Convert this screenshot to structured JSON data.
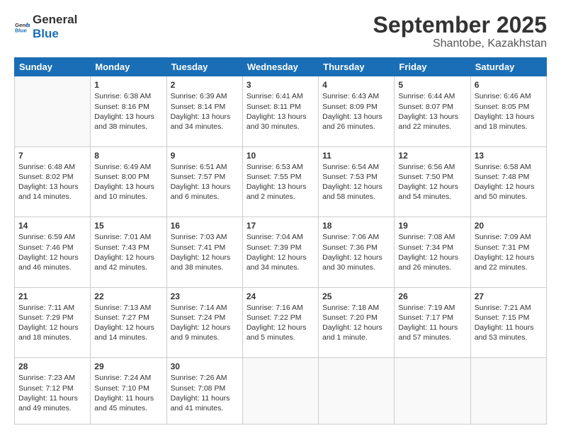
{
  "header": {
    "logo_general": "General",
    "logo_blue": "Blue",
    "month_title": "September 2025",
    "location": "Shantobe, Kazakhstan"
  },
  "days_of_week": [
    "Sunday",
    "Monday",
    "Tuesday",
    "Wednesday",
    "Thursday",
    "Friday",
    "Saturday"
  ],
  "weeks": [
    [
      {
        "day": "",
        "sunrise": "",
        "sunset": "",
        "daylight": "",
        "empty": true
      },
      {
        "day": "1",
        "sunrise": "Sunrise: 6:38 AM",
        "sunset": "Sunset: 8:16 PM",
        "daylight": "Daylight: 13 hours and 38 minutes."
      },
      {
        "day": "2",
        "sunrise": "Sunrise: 6:39 AM",
        "sunset": "Sunset: 8:14 PM",
        "daylight": "Daylight: 13 hours and 34 minutes."
      },
      {
        "day": "3",
        "sunrise": "Sunrise: 6:41 AM",
        "sunset": "Sunset: 8:11 PM",
        "daylight": "Daylight: 13 hours and 30 minutes."
      },
      {
        "day": "4",
        "sunrise": "Sunrise: 6:43 AM",
        "sunset": "Sunset: 8:09 PM",
        "daylight": "Daylight: 13 hours and 26 minutes."
      },
      {
        "day": "5",
        "sunrise": "Sunrise: 6:44 AM",
        "sunset": "Sunset: 8:07 PM",
        "daylight": "Daylight: 13 hours and 22 minutes."
      },
      {
        "day": "6",
        "sunrise": "Sunrise: 6:46 AM",
        "sunset": "Sunset: 8:05 PM",
        "daylight": "Daylight: 13 hours and 18 minutes."
      }
    ],
    [
      {
        "day": "7",
        "sunrise": "Sunrise: 6:48 AM",
        "sunset": "Sunset: 8:02 PM",
        "daylight": "Daylight: 13 hours and 14 minutes."
      },
      {
        "day": "8",
        "sunrise": "Sunrise: 6:49 AM",
        "sunset": "Sunset: 8:00 PM",
        "daylight": "Daylight: 13 hours and 10 minutes."
      },
      {
        "day": "9",
        "sunrise": "Sunrise: 6:51 AM",
        "sunset": "Sunset: 7:57 PM",
        "daylight": "Daylight: 13 hours and 6 minutes."
      },
      {
        "day": "10",
        "sunrise": "Sunrise: 6:53 AM",
        "sunset": "Sunset: 7:55 PM",
        "daylight": "Daylight: 13 hours and 2 minutes."
      },
      {
        "day": "11",
        "sunrise": "Sunrise: 6:54 AM",
        "sunset": "Sunset: 7:53 PM",
        "daylight": "Daylight: 12 hours and 58 minutes."
      },
      {
        "day": "12",
        "sunrise": "Sunrise: 6:56 AM",
        "sunset": "Sunset: 7:50 PM",
        "daylight": "Daylight: 12 hours and 54 minutes."
      },
      {
        "day": "13",
        "sunrise": "Sunrise: 6:58 AM",
        "sunset": "Sunset: 7:48 PM",
        "daylight": "Daylight: 12 hours and 50 minutes."
      }
    ],
    [
      {
        "day": "14",
        "sunrise": "Sunrise: 6:59 AM",
        "sunset": "Sunset: 7:46 PM",
        "daylight": "Daylight: 12 hours and 46 minutes."
      },
      {
        "day": "15",
        "sunrise": "Sunrise: 7:01 AM",
        "sunset": "Sunset: 7:43 PM",
        "daylight": "Daylight: 12 hours and 42 minutes."
      },
      {
        "day": "16",
        "sunrise": "Sunrise: 7:03 AM",
        "sunset": "Sunset: 7:41 PM",
        "daylight": "Daylight: 12 hours and 38 minutes."
      },
      {
        "day": "17",
        "sunrise": "Sunrise: 7:04 AM",
        "sunset": "Sunset: 7:39 PM",
        "daylight": "Daylight: 12 hours and 34 minutes."
      },
      {
        "day": "18",
        "sunrise": "Sunrise: 7:06 AM",
        "sunset": "Sunset: 7:36 PM",
        "daylight": "Daylight: 12 hours and 30 minutes."
      },
      {
        "day": "19",
        "sunrise": "Sunrise: 7:08 AM",
        "sunset": "Sunset: 7:34 PM",
        "daylight": "Daylight: 12 hours and 26 minutes."
      },
      {
        "day": "20",
        "sunrise": "Sunrise: 7:09 AM",
        "sunset": "Sunset: 7:31 PM",
        "daylight": "Daylight: 12 hours and 22 minutes."
      }
    ],
    [
      {
        "day": "21",
        "sunrise": "Sunrise: 7:11 AM",
        "sunset": "Sunset: 7:29 PM",
        "daylight": "Daylight: 12 hours and 18 minutes."
      },
      {
        "day": "22",
        "sunrise": "Sunrise: 7:13 AM",
        "sunset": "Sunset: 7:27 PM",
        "daylight": "Daylight: 12 hours and 14 minutes."
      },
      {
        "day": "23",
        "sunrise": "Sunrise: 7:14 AM",
        "sunset": "Sunset: 7:24 PM",
        "daylight": "Daylight: 12 hours and 9 minutes."
      },
      {
        "day": "24",
        "sunrise": "Sunrise: 7:16 AM",
        "sunset": "Sunset: 7:22 PM",
        "daylight": "Daylight: 12 hours and 5 minutes."
      },
      {
        "day": "25",
        "sunrise": "Sunrise: 7:18 AM",
        "sunset": "Sunset: 7:20 PM",
        "daylight": "Daylight: 12 hours and 1 minute."
      },
      {
        "day": "26",
        "sunrise": "Sunrise: 7:19 AM",
        "sunset": "Sunset: 7:17 PM",
        "daylight": "Daylight: 11 hours and 57 minutes."
      },
      {
        "day": "27",
        "sunrise": "Sunrise: 7:21 AM",
        "sunset": "Sunset: 7:15 PM",
        "daylight": "Daylight: 11 hours and 53 minutes."
      }
    ],
    [
      {
        "day": "28",
        "sunrise": "Sunrise: 7:23 AM",
        "sunset": "Sunset: 7:12 PM",
        "daylight": "Daylight: 11 hours and 49 minutes."
      },
      {
        "day": "29",
        "sunrise": "Sunrise: 7:24 AM",
        "sunset": "Sunset: 7:10 PM",
        "daylight": "Daylight: 11 hours and 45 minutes."
      },
      {
        "day": "30",
        "sunrise": "Sunrise: 7:26 AM",
        "sunset": "Sunset: 7:08 PM",
        "daylight": "Daylight: 11 hours and 41 minutes."
      },
      {
        "day": "",
        "sunrise": "",
        "sunset": "",
        "daylight": "",
        "empty": true
      },
      {
        "day": "",
        "sunrise": "",
        "sunset": "",
        "daylight": "",
        "empty": true
      },
      {
        "day": "",
        "sunrise": "",
        "sunset": "",
        "daylight": "",
        "empty": true
      },
      {
        "day": "",
        "sunrise": "",
        "sunset": "",
        "daylight": "",
        "empty": true
      }
    ]
  ]
}
